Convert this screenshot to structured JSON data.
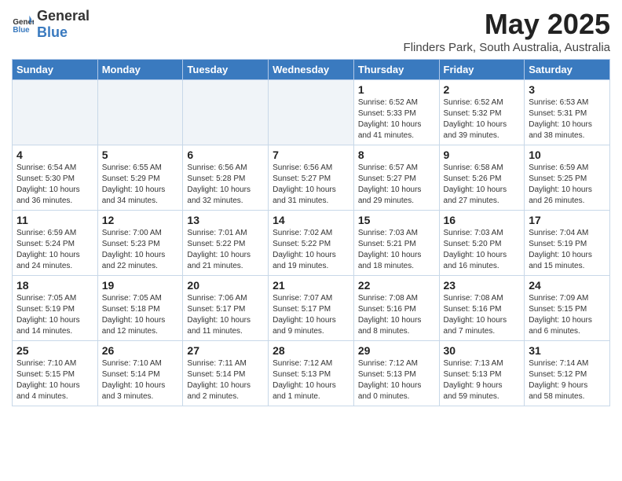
{
  "logo": {
    "general": "General",
    "blue": "Blue"
  },
  "header": {
    "title": "May 2025",
    "location": "Flinders Park, South Australia, Australia"
  },
  "weekdays": [
    "Sunday",
    "Monday",
    "Tuesday",
    "Wednesday",
    "Thursday",
    "Friday",
    "Saturday"
  ],
  "weeks": [
    [
      {
        "day": "",
        "info": ""
      },
      {
        "day": "",
        "info": ""
      },
      {
        "day": "",
        "info": ""
      },
      {
        "day": "",
        "info": ""
      },
      {
        "day": "1",
        "info": "Sunrise: 6:52 AM\nSunset: 5:33 PM\nDaylight: 10 hours\nand 41 minutes."
      },
      {
        "day": "2",
        "info": "Sunrise: 6:52 AM\nSunset: 5:32 PM\nDaylight: 10 hours\nand 39 minutes."
      },
      {
        "day": "3",
        "info": "Sunrise: 6:53 AM\nSunset: 5:31 PM\nDaylight: 10 hours\nand 38 minutes."
      }
    ],
    [
      {
        "day": "4",
        "info": "Sunrise: 6:54 AM\nSunset: 5:30 PM\nDaylight: 10 hours\nand 36 minutes."
      },
      {
        "day": "5",
        "info": "Sunrise: 6:55 AM\nSunset: 5:29 PM\nDaylight: 10 hours\nand 34 minutes."
      },
      {
        "day": "6",
        "info": "Sunrise: 6:56 AM\nSunset: 5:28 PM\nDaylight: 10 hours\nand 32 minutes."
      },
      {
        "day": "7",
        "info": "Sunrise: 6:56 AM\nSunset: 5:27 PM\nDaylight: 10 hours\nand 31 minutes."
      },
      {
        "day": "8",
        "info": "Sunrise: 6:57 AM\nSunset: 5:27 PM\nDaylight: 10 hours\nand 29 minutes."
      },
      {
        "day": "9",
        "info": "Sunrise: 6:58 AM\nSunset: 5:26 PM\nDaylight: 10 hours\nand 27 minutes."
      },
      {
        "day": "10",
        "info": "Sunrise: 6:59 AM\nSunset: 5:25 PM\nDaylight: 10 hours\nand 26 minutes."
      }
    ],
    [
      {
        "day": "11",
        "info": "Sunrise: 6:59 AM\nSunset: 5:24 PM\nDaylight: 10 hours\nand 24 minutes."
      },
      {
        "day": "12",
        "info": "Sunrise: 7:00 AM\nSunset: 5:23 PM\nDaylight: 10 hours\nand 22 minutes."
      },
      {
        "day": "13",
        "info": "Sunrise: 7:01 AM\nSunset: 5:22 PM\nDaylight: 10 hours\nand 21 minutes."
      },
      {
        "day": "14",
        "info": "Sunrise: 7:02 AM\nSunset: 5:22 PM\nDaylight: 10 hours\nand 19 minutes."
      },
      {
        "day": "15",
        "info": "Sunrise: 7:03 AM\nSunset: 5:21 PM\nDaylight: 10 hours\nand 18 minutes."
      },
      {
        "day": "16",
        "info": "Sunrise: 7:03 AM\nSunset: 5:20 PM\nDaylight: 10 hours\nand 16 minutes."
      },
      {
        "day": "17",
        "info": "Sunrise: 7:04 AM\nSunset: 5:19 PM\nDaylight: 10 hours\nand 15 minutes."
      }
    ],
    [
      {
        "day": "18",
        "info": "Sunrise: 7:05 AM\nSunset: 5:19 PM\nDaylight: 10 hours\nand 14 minutes."
      },
      {
        "day": "19",
        "info": "Sunrise: 7:05 AM\nSunset: 5:18 PM\nDaylight: 10 hours\nand 12 minutes."
      },
      {
        "day": "20",
        "info": "Sunrise: 7:06 AM\nSunset: 5:17 PM\nDaylight: 10 hours\nand 11 minutes."
      },
      {
        "day": "21",
        "info": "Sunrise: 7:07 AM\nSunset: 5:17 PM\nDaylight: 10 hours\nand 9 minutes."
      },
      {
        "day": "22",
        "info": "Sunrise: 7:08 AM\nSunset: 5:16 PM\nDaylight: 10 hours\nand 8 minutes."
      },
      {
        "day": "23",
        "info": "Sunrise: 7:08 AM\nSunset: 5:16 PM\nDaylight: 10 hours\nand 7 minutes."
      },
      {
        "day": "24",
        "info": "Sunrise: 7:09 AM\nSunset: 5:15 PM\nDaylight: 10 hours\nand 6 minutes."
      }
    ],
    [
      {
        "day": "25",
        "info": "Sunrise: 7:10 AM\nSunset: 5:15 PM\nDaylight: 10 hours\nand 4 minutes."
      },
      {
        "day": "26",
        "info": "Sunrise: 7:10 AM\nSunset: 5:14 PM\nDaylight: 10 hours\nand 3 minutes."
      },
      {
        "day": "27",
        "info": "Sunrise: 7:11 AM\nSunset: 5:14 PM\nDaylight: 10 hours\nand 2 minutes."
      },
      {
        "day": "28",
        "info": "Sunrise: 7:12 AM\nSunset: 5:13 PM\nDaylight: 10 hours\nand 1 minute."
      },
      {
        "day": "29",
        "info": "Sunrise: 7:12 AM\nSunset: 5:13 PM\nDaylight: 10 hours\nand 0 minutes."
      },
      {
        "day": "30",
        "info": "Sunrise: 7:13 AM\nSunset: 5:13 PM\nDaylight: 9 hours\nand 59 minutes."
      },
      {
        "day": "31",
        "info": "Sunrise: 7:14 AM\nSunset: 5:12 PM\nDaylight: 9 hours\nand 58 minutes."
      }
    ]
  ]
}
